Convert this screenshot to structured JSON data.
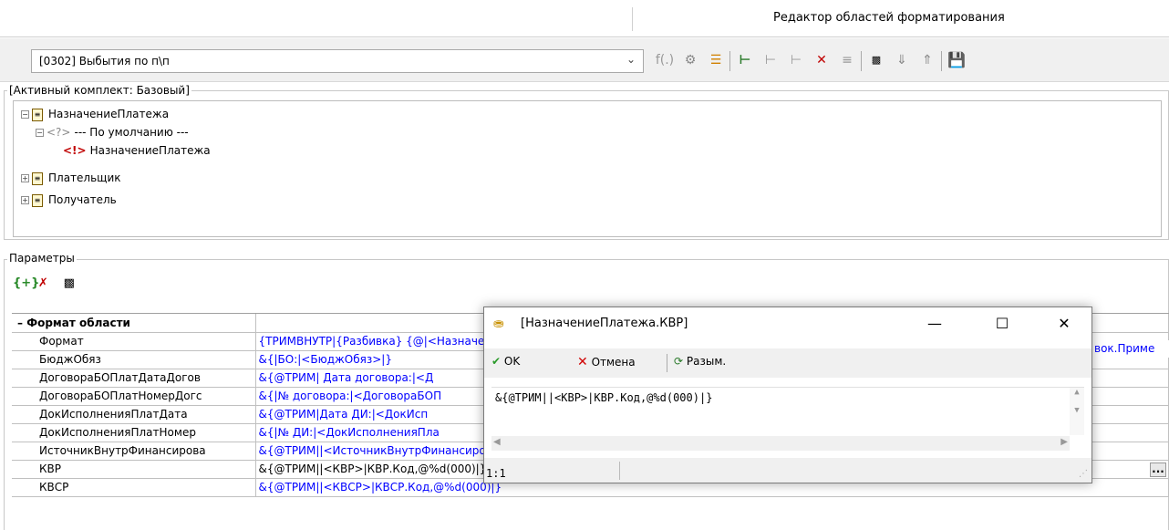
{
  "window": {
    "title": "Редактор областей форматирования"
  },
  "toolbar": {
    "combo_value": "[0302] Выбытия по п\\п",
    "icons": [
      "function-icon",
      "shield-icon",
      "list-icon",
      "add-node-icon",
      "move-node-b-icon",
      "move-node-0-icon",
      "delete-node-icon",
      "disabled-node-icon",
      "ai-icon",
      "move-down-icon",
      "move-up-icon",
      "save-icon"
    ]
  },
  "tree": {
    "group_label": "[Активный комплект: Базовый]",
    "nodes": [
      {
        "label": "НазначениеПлатежа",
        "expander": "−"
      },
      {
        "label": "--- По умолчанию ---",
        "expander": "−"
      },
      {
        "label": "НазначениеПлатежа"
      },
      {
        "label": "Плательщик",
        "expander": "+"
      },
      {
        "label": "Получатель",
        "expander": "+"
      }
    ]
  },
  "params": {
    "group_label": "Параметры",
    "section_title": "Формат области",
    "rows": [
      {
        "name": "Формат",
        "value": "{ТРИМВНУТР|{Разбивка} {@|<НазначениеПлатежа>|НазначениеПлатежа.Значение|} {@|<СписокПриме"
      },
      {
        "name": "БюджОбяз",
        "value": "&{|БО:|<БюджОбяз>|}"
      },
      {
        "name": "ДоговораБОПлатДатаДогов",
        "value": "&{@ТРИМ| Дата договора:|<Д"
      },
      {
        "name": "ДоговораБОПлатНомерДогс",
        "value": "&{|№ договора:|<ДоговораБОП"
      },
      {
        "name": "ДокИсполненияПлатДата",
        "value": "&{@ТРИМ|Дата ДИ:|<ДокИсп"
      },
      {
        "name": "ДокИсполненияПлатНомер",
        "value": "&{|№ ДИ:|<ДокИсполненияПла"
      },
      {
        "name": "ИсточникВнутрФинансирова",
        "value": "&{@ТРИМ||<ИсточникВнутрФинансирования>|ИсточникВнутр_Финансирования.Код|}"
      },
      {
        "name": "КВР",
        "value": "&{@ТРИМ||<КВР>|КВР.Код,@%d(000)|}",
        "active": true
      },
      {
        "name": "КВСР",
        "value": "&{@ТРИМ||<КВСР>|КВСР.Код,@%d(000)|}"
      }
    ],
    "visible_tail": "вок.Приме",
    "ellipsis": "..."
  },
  "dialog": {
    "title": "[НазначениеПлатежа.КВР]",
    "ok_label": "OK",
    "cancel_label": "Отмена",
    "unwrap_label": "Разым.",
    "editor_text": "&{@ТРИМ||<КВР>|КВР.Код,@%d(000)|}",
    "status_pos": "1:1"
  }
}
